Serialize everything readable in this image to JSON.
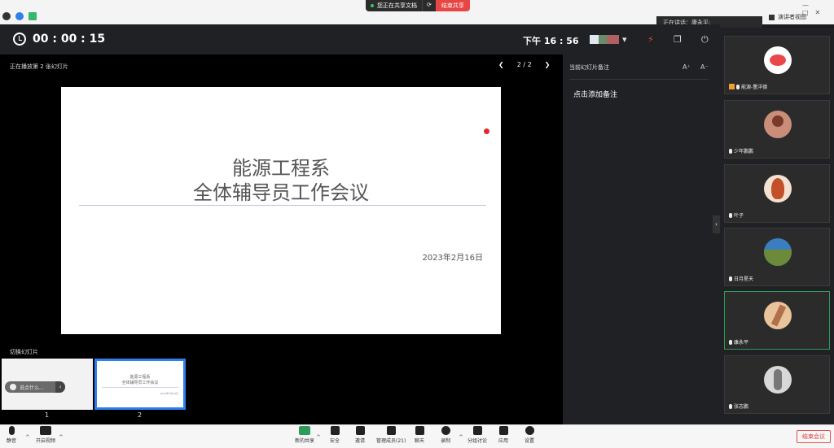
{
  "share_bar": {
    "status": "您正在共享文档",
    "end_label": "结束共享"
  },
  "speaking": {
    "label": "正在讲话：康永平;"
  },
  "view_mode": {
    "label": "演讲者视图"
  },
  "header": {
    "timer": "00 : 00 : 15",
    "clock": "下午 16 : 56"
  },
  "slideshow": {
    "now_playing": "正在播放第 2 张幻灯片",
    "pager": "2 / 2",
    "slide": {
      "title_line1": "能源工程系",
      "title_line2": "全体辅导员工作会议",
      "date": "2023年2月16日"
    },
    "switch_label": "切换幻灯片",
    "thumbs": [
      {
        "number": "1"
      },
      {
        "number": "2"
      }
    ],
    "chat_placeholder": "说点什么..."
  },
  "notes": {
    "title": "当前幻灯片备注",
    "font_up": "A⁺",
    "font_down": "A⁻",
    "add": "点击添加备注"
  },
  "participants": [
    {
      "name": "能源-董洋德",
      "avatar": "#ffffff",
      "accent": "#e9484b"
    },
    {
      "name": "少年鹏鹏",
      "avatar": "#c98d7a",
      "accent": "#7a3a2a"
    },
    {
      "name": "叶子",
      "avatar": "#f3e2d2",
      "accent": "#c4502a"
    },
    {
      "name": "日月星天",
      "avatar": "#3a7dc1",
      "accent": "#6b8a3a"
    },
    {
      "name": "康永平",
      "avatar": "#e8c39b",
      "accent": "#b0704a"
    },
    {
      "name": "张志鹏",
      "avatar": "#d8d8d8",
      "accent": "#777777"
    }
  ],
  "toolbar": {
    "mute": "静音",
    "video": "开启视频",
    "share": "新的共享",
    "security": "安全",
    "record_doc": "邀请",
    "members": "管理成员(21)",
    "chat": "聊天",
    "record": "录制",
    "breakout": "分组讨论",
    "apps": "应用",
    "settings": "设置",
    "end": "结束会议"
  }
}
